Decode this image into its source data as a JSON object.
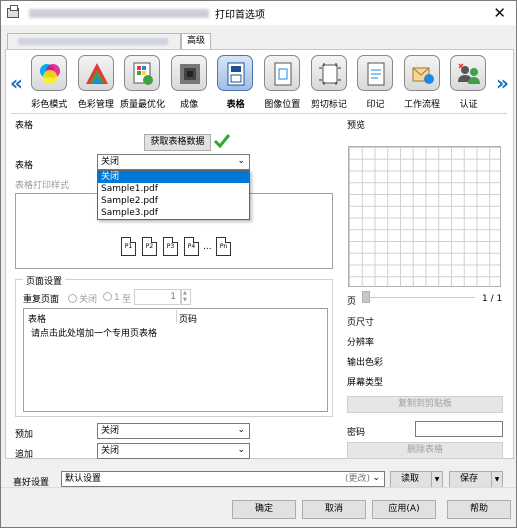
{
  "window": {
    "title": "打印首选项",
    "close_glyph": "✕"
  },
  "tabs": [
    {
      "label": ""
    },
    {
      "label": "高级"
    }
  ],
  "toolbar": {
    "left_arrow": "«",
    "right_arrow": "»",
    "items": [
      {
        "label": "彩色模式",
        "icon": "color-mode-icon"
      },
      {
        "label": "色彩管理",
        "icon": "color-management-icon"
      },
      {
        "label": "质量最优化",
        "icon": "quality-icon"
      },
      {
        "label": "成像",
        "icon": "imaging-icon"
      },
      {
        "label": "表格",
        "icon": "form-icon",
        "active": true
      },
      {
        "label": "图像位置",
        "icon": "image-position-icon"
      },
      {
        "label": "剪切标记",
        "icon": "crop-marks-icon"
      },
      {
        "label": "印记",
        "icon": "stamp-icon"
      },
      {
        "label": "工作流程",
        "icon": "workflow-icon"
      },
      {
        "label": "认证",
        "icon": "authentication-icon"
      }
    ]
  },
  "form_section": {
    "heading": "表格",
    "get_form_data_button": "获取表格数据",
    "form_label": "表格",
    "form_select": {
      "value": "关闭",
      "options": [
        "关闭",
        "Sample1.pdf",
        "Sample2.pdf",
        "Sample3.pdf"
      ]
    },
    "print_style_label": "表格打印样式",
    "pages": [
      "P1",
      "P2",
      "P3",
      "P4",
      "...",
      "Pn"
    ]
  },
  "page_settings": {
    "heading": "页面设置",
    "repeat_label": "重复页面",
    "radio_off": "关闭",
    "radio_from": "1",
    "to_label": "至",
    "stepper_value": "1",
    "table_headers": [
      "表格",
      "页码"
    ],
    "add_prompt": "请点击此处增加一个专用页表格"
  },
  "prepend": {
    "label": "预加",
    "value": "关闭"
  },
  "append": {
    "label": "追加",
    "value": "关闭"
  },
  "preview": {
    "heading": "预览",
    "page_label": "页",
    "page_count": "1 / 1",
    "page_size_label": "页尺寸",
    "resolution_label": "分辨率",
    "output_color_label": "输出色彩",
    "screen_type_label": "屏幕类型",
    "copy_button": "复制到剪贴板",
    "password_label": "密码",
    "password_value": "",
    "delete_button": "删除表格"
  },
  "favorites": {
    "label": "喜好设置",
    "value": "默认设置",
    "change_hint": "(更改)",
    "load_button": "读取",
    "save_button": "保存"
  },
  "footer": {
    "ok": "确定",
    "cancel": "取消",
    "apply": "应用(A)",
    "help": "帮助"
  }
}
